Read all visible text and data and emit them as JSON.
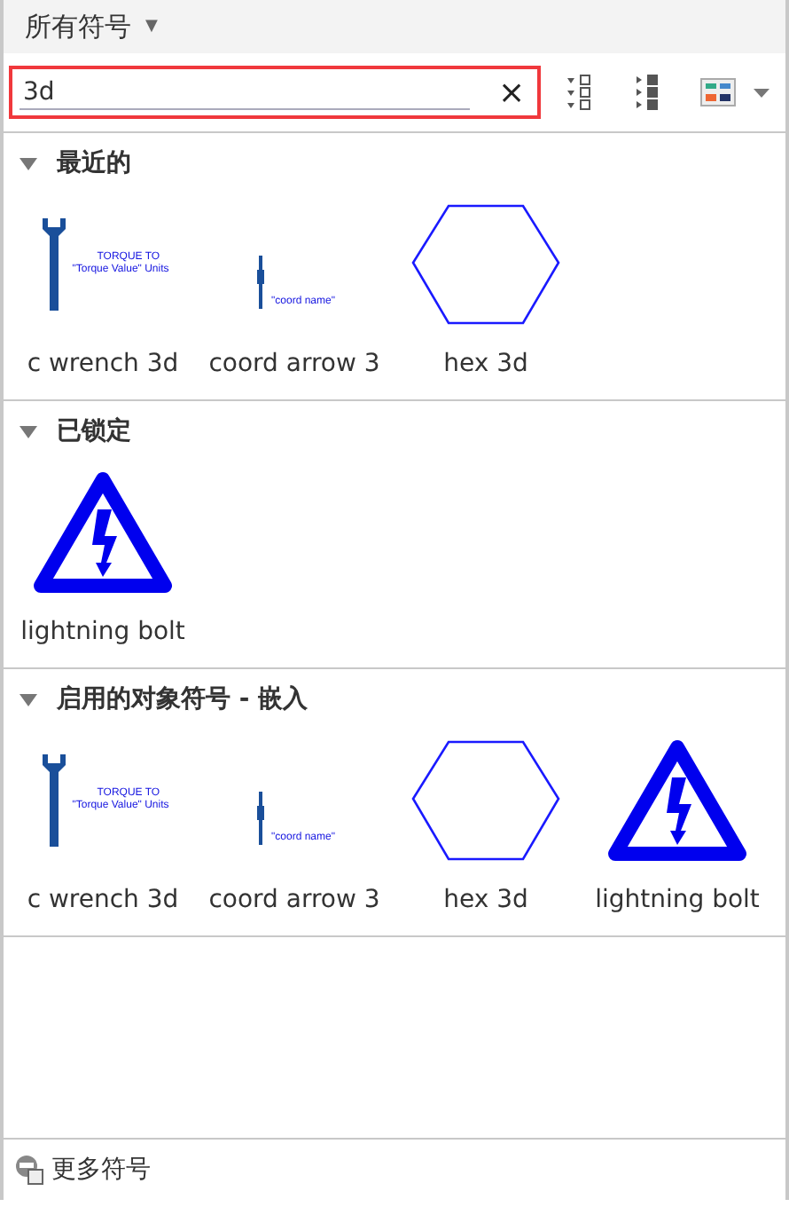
{
  "header": {
    "title": "所有符号",
    "caret": "▼"
  },
  "search": {
    "value": "3d",
    "clear": "×",
    "highlighted": true
  },
  "sections": [
    {
      "title": "最近的",
      "expanded": true,
      "items": [
        {
          "kind": "wrench",
          "label": "c wrench 3d",
          "preview_text": [
            "TORQUE TO",
            "\"Torque Value\" Units"
          ]
        },
        {
          "kind": "arrow",
          "label": "coord arrow 3",
          "preview_text": [
            "\"coord name\""
          ]
        },
        {
          "kind": "hex",
          "label": "hex 3d"
        }
      ]
    },
    {
      "title": "已锁定",
      "expanded": true,
      "items": [
        {
          "kind": "warning",
          "label": "lightning bolt"
        }
      ]
    },
    {
      "title": "启用的对象符号 - 嵌入",
      "expanded": true,
      "items": [
        {
          "kind": "wrench",
          "label": "c wrench 3d",
          "preview_text": [
            "TORQUE TO",
            "\"Torque Value\" Units"
          ]
        },
        {
          "kind": "arrow",
          "label": "coord arrow 3",
          "preview_text": [
            "\"coord name\""
          ]
        },
        {
          "kind": "hex",
          "label": "hex 3d"
        },
        {
          "kind": "warning",
          "label": "lightning bolt"
        }
      ]
    }
  ],
  "footer": {
    "label": "更多符号"
  }
}
